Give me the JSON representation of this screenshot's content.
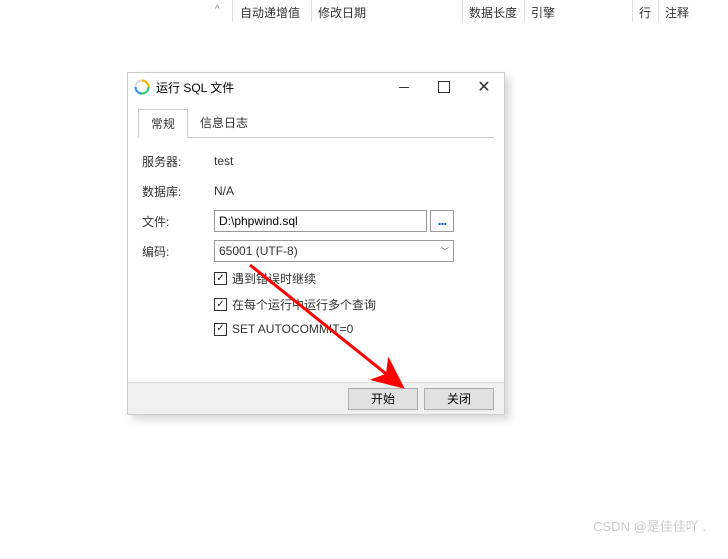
{
  "bg_columns": {
    "auto_inc": "自动递增值",
    "mod_date": "修改日期",
    "data_len": "数据长度",
    "engine": "引擎",
    "rows": "行",
    "comment": "注释"
  },
  "dialog": {
    "title": "运行 SQL 文件",
    "tabs": {
      "general": "常规",
      "log": "信息日志"
    },
    "labels": {
      "server": "服务器:",
      "database": "数据库:",
      "file": "文件:",
      "encoding": "编码:"
    },
    "values": {
      "server": "test",
      "database": "N/A",
      "file": "D:\\phpwind.sql",
      "encoding": "65001 (UTF-8)"
    },
    "browse": "...",
    "checks": {
      "continue": "遇到错误时继续",
      "multi": "在每个运行中运行多个查询",
      "autocommit": "SET AUTOCOMMIT=0"
    },
    "buttons": {
      "start": "开始",
      "close": "关闭"
    }
  },
  "watermark": "CSDN @是佳佳吖  ."
}
